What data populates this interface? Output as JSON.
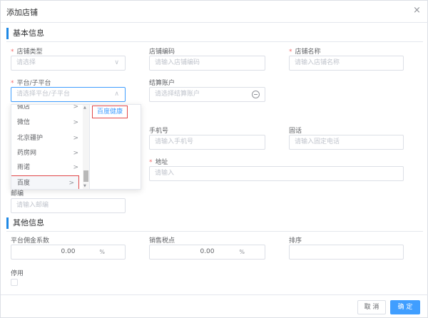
{
  "dialog": {
    "title": "添加店铺",
    "close_glyph": "×"
  },
  "sections": {
    "basic": "基本信息",
    "other": "其他信息"
  },
  "required_mark": "*",
  "fields": {
    "shop_type": {
      "label": "店铺类型",
      "placeholder": "请选择"
    },
    "shop_code": {
      "label": "店铺编码",
      "placeholder": "请输入店铺编码"
    },
    "shop_name": {
      "label": "店铺名称",
      "placeholder": "请输入店铺名称"
    },
    "platform": {
      "label": "平台/子平台",
      "placeholder": "请选择平台/子平台"
    },
    "settle_account": {
      "label": "结算账户",
      "placeholder": "请选择结算账户"
    },
    "phone": {
      "label": "手机号",
      "placeholder": "请输入手机号"
    },
    "landline": {
      "label": "固话",
      "placeholder": "请输入固定电话"
    },
    "address": {
      "label": "地址",
      "placeholder": "请输入"
    },
    "postcode": {
      "label": "邮编",
      "placeholder": "请输入邮编"
    },
    "commission": {
      "label": "平台佣金系数",
      "value": "0.00",
      "suffix": "%"
    },
    "tax": {
      "label": "销售税点",
      "value": "0.00",
      "suffix": "%"
    },
    "sort": {
      "label": "排序",
      "value": ""
    },
    "disabled": {
      "label": "停用",
      "checked": false
    }
  },
  "cascader": {
    "level1": [
      {
        "label": "微店"
      },
      {
        "label": "微信"
      },
      {
        "label": "北京疆护"
      },
      {
        "label": "药房网"
      },
      {
        "label": "雨诺"
      },
      {
        "label": "百度",
        "active": true
      }
    ],
    "level2": [
      {
        "label": "百度健康"
      }
    ],
    "chevron_glyph": ">"
  },
  "footer": {
    "cancel_label": "取 消",
    "confirm_label": "确 定"
  },
  "icons": {
    "select_arrow": "chevron-down-icon",
    "cascader_open": "chevron-up-icon",
    "settle": "minus-circle-icon"
  },
  "colors": {
    "accent": "#409eff",
    "required": "#f56c6c",
    "section_bar": "#1e88e5",
    "highlight": "#e04848"
  }
}
